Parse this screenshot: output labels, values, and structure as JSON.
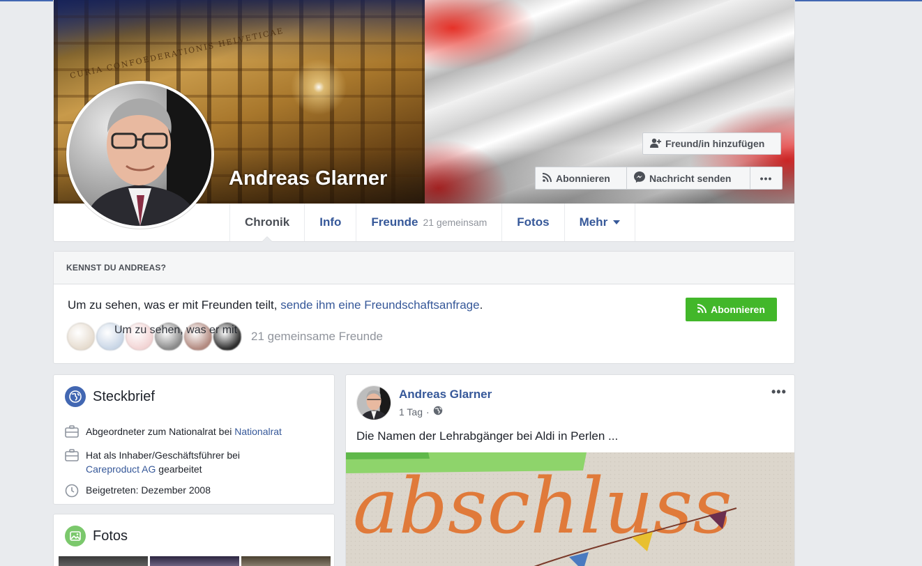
{
  "profile": {
    "name": "Andreas Glarner",
    "cover_inscription": "CURIA CONFOEDERATIONIS HELVETICAE"
  },
  "cover_buttons": {
    "add_friend": "Freund/in hinzufügen",
    "subscribe": "Abonnieren",
    "message": "Nachricht senden",
    "more": "•••"
  },
  "tabs": [
    {
      "label": "Chronik",
      "sub": ""
    },
    {
      "label": "Info",
      "sub": ""
    },
    {
      "label": "Freunde",
      "sub": "21 gemeinsam"
    },
    {
      "label": "Fotos",
      "sub": ""
    },
    {
      "label": "Mehr",
      "sub": ""
    }
  ],
  "know": {
    "heading": "KENNST DU ANDREAS?",
    "text_before": "Um zu sehen, was er mit Freunden teilt, ",
    "text_link": "sende ihm eine Freundschaftsanfrage",
    "text_after": ".",
    "button": "Abonnieren",
    "ghost_text": "Um zu sehen, was er mit",
    "mutual_friends": "21 gemeinsame Freunde",
    "friend_avatar_colors": [
      "#e6dccf",
      "#c9d6e6",
      "#f2d4d4",
      "#8a8a8a",
      "#b38a80",
      "#2e2e2e"
    ]
  },
  "steckbrief": {
    "title": "Steckbrief",
    "items": [
      {
        "icon": "briefcase-icon",
        "text": "Abgeordneter zum Nationalrat bei ",
        "link": "Nationalrat",
        "after": ""
      },
      {
        "icon": "briefcase-icon",
        "text": "Hat als Inhaber/Geschäftsführer bei ",
        "link": "Careproduct AG",
        "after": " gearbeitet"
      },
      {
        "icon": "clock-icon",
        "text": "Beigetreten: Dezember 2008",
        "link": "",
        "after": ""
      }
    ]
  },
  "fotos": {
    "title": "Fotos"
  },
  "post": {
    "author": "Andreas Glarner",
    "time": "1 Tag",
    "separator": "·",
    "text": "Die Namen der Lehrabgänger bei Aldi in Perlen ...",
    "image_lettering": "abschluss",
    "more": "•••"
  },
  "colors": {
    "link": "#365899",
    "green_button": "#42b72a",
    "page_bg": "#e9ebee"
  }
}
